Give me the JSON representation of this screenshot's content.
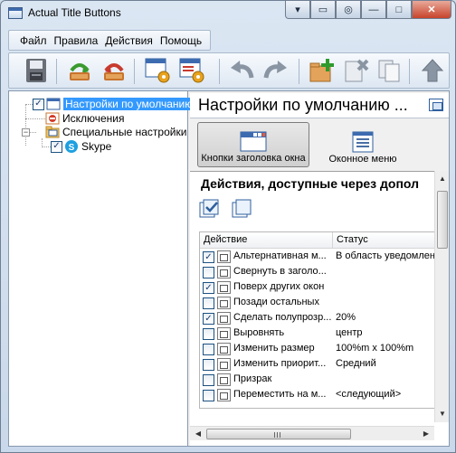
{
  "window": {
    "title": "Actual Title Buttons",
    "caption_buttons": [
      "▾",
      "▭",
      "◎",
      "—",
      "□",
      "✕"
    ]
  },
  "menu": [
    "Файл",
    "Правила",
    "Действия",
    "Помощь"
  ],
  "toolbar": {
    "buttons": [
      "save-icon",
      "import-icon",
      "export-icon",
      "window-settings-icon",
      "window-rules-icon",
      "undo-icon",
      "redo-icon",
      "new-rule-icon",
      "delete-rule-icon",
      "copy-rule-icon",
      "move-up-icon"
    ]
  },
  "tree": {
    "default_settings": "Настройки по умолчанию",
    "exceptions": "Исключения",
    "specific_settings": "Специальные настройки",
    "skype": "Skype"
  },
  "right_pane": {
    "header_title": "Настройки по умолчанию ...",
    "tab_title_buttons": "Кнопки заголовка окна",
    "tab_window_menu": "Оконное меню",
    "panel_title": "Действия, доступные через допол",
    "columns": {
      "action": "Действие",
      "status": "Статус"
    },
    "rows": [
      {
        "name": "Альтернативная м...",
        "status": "В область уведомлени",
        "checked": true
      },
      {
        "name": "Свернуть в заголо...",
        "status": "",
        "checked": false
      },
      {
        "name": "Поверх других окон",
        "status": "",
        "checked": true
      },
      {
        "name": "Позади остальных",
        "status": "",
        "checked": false
      },
      {
        "name": "Сделать полупрозр...",
        "status": "20%",
        "checked": true
      },
      {
        "name": "Выровнять",
        "status": "центр",
        "checked": false
      },
      {
        "name": "Изменить размер",
        "status": "100%m x 100%m",
        "checked": false
      },
      {
        "name": "Изменить приорит...",
        "status": "Средний",
        "checked": false
      },
      {
        "name": "Призрак",
        "status": "",
        "checked": false
      },
      {
        "name": "Переместить на м...",
        "status": "<следующий>",
        "checked": false
      }
    ]
  },
  "colors": {
    "selection": "#3399ff",
    "frame": "#c9d8ea",
    "close": "#c7432a"
  }
}
